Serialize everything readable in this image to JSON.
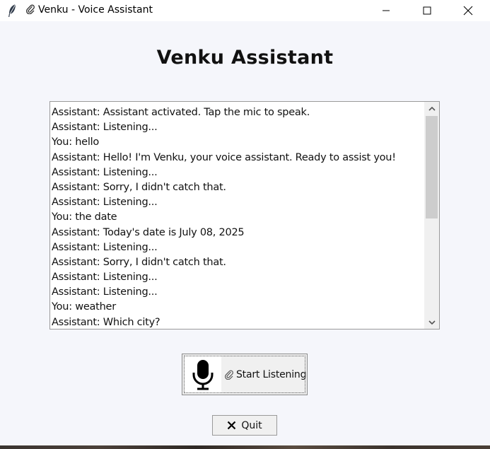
{
  "window": {
    "title": "Venku - Voice Assistant",
    "app_icon": "feather-icon",
    "title_icon": "paperclip-icon",
    "controls": [
      "minimize-icon",
      "maximize-icon",
      "close-icon"
    ]
  },
  "heading": "Venku Assistant",
  "log": {
    "lines": [
      "Assistant: Assistant activated. Tap the mic to speak.",
      "Assistant: Listening...",
      "You: hello",
      "Assistant: Hello! I'm Venku, your voice assistant. Ready to assist you!",
      "Assistant: Listening...",
      "Assistant: Sorry, I didn't catch that.",
      "Assistant: Listening...",
      "You: the date",
      "Assistant: Today's date is July 08, 2025",
      "Assistant: Listening...",
      "Assistant: Sorry, I didn't catch that.",
      "Assistant: Listening...",
      "Assistant: Listening...",
      "You: weather",
      "Assistant: Which city?"
    ]
  },
  "buttons": {
    "listen_label": "Start Listening",
    "listen_icon": "microphone-icon",
    "listen_label_icon": "paperclip-icon",
    "quit_label": "Quit",
    "quit_icon": "x-icon"
  },
  "colors": {
    "background": "#f5f6fb",
    "button_face": "#f0f0f0",
    "text": "#111111"
  }
}
